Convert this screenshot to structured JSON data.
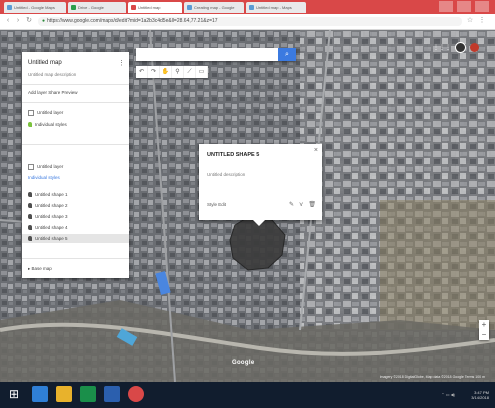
{
  "browser": {
    "tabs": [
      {
        "label": "Untitled - Google Maps",
        "fav": "#5b9bd5"
      },
      {
        "label": "Drive - Google",
        "fav": "#2a9d4b"
      },
      {
        "label": "Untitled map",
        "fav": "#d94848"
      },
      {
        "label": "Creating map - Google",
        "fav": "#5b9bd5"
      },
      {
        "label": "Untitled map - Maps",
        "fav": "#5b9bd5"
      }
    ],
    "url": "https://www.google.com/maps/d/edit?mid=1a2b3c4d5e&ll=28.64,77.21&z=17"
  },
  "search": {
    "placeholder": "",
    "button_icon": "search-icon"
  },
  "toolbar": {
    "buttons": [
      "undo-icon",
      "redo-icon",
      "hand-icon",
      "marker-icon",
      "line-icon",
      "ruler-icon"
    ]
  },
  "panel": {
    "title": "Untitled map",
    "subtitle": "Untitled map description",
    "actions": "Add layer   Share   Preview",
    "layer1_name": "Untitled layer",
    "layer1_style": "Individual styles",
    "layer2_name": "Untitled layer",
    "layer2_link": "Individual styles",
    "items": [
      "Untitled shape 1",
      "Untitled shape 2",
      "Untitled shape 3",
      "Untitled shape 4",
      "Untitled shape 5"
    ],
    "basemap": "Base map"
  },
  "popup": {
    "title": "UNTITLED SHAPE 5",
    "description": "Untitled description",
    "footer": "Style  Edit"
  },
  "map": {
    "footer": "Imagery ©2018 DigitalGlobe, Map data ©2018 Google  Terms  100 m"
  },
  "taskbar": {
    "apps": [
      {
        "name": "edge-icon",
        "color": "#2f7fd6"
      },
      {
        "name": "file-explorer-icon",
        "color": "#e8b22c"
      },
      {
        "name": "store-icon",
        "color": "#1a8f4a"
      },
      {
        "name": "word-icon",
        "color": "#2b5fae"
      },
      {
        "name": "chrome-icon",
        "color": "#d94848"
      }
    ],
    "time": "3:47 PM",
    "date": "3/14/2018"
  }
}
